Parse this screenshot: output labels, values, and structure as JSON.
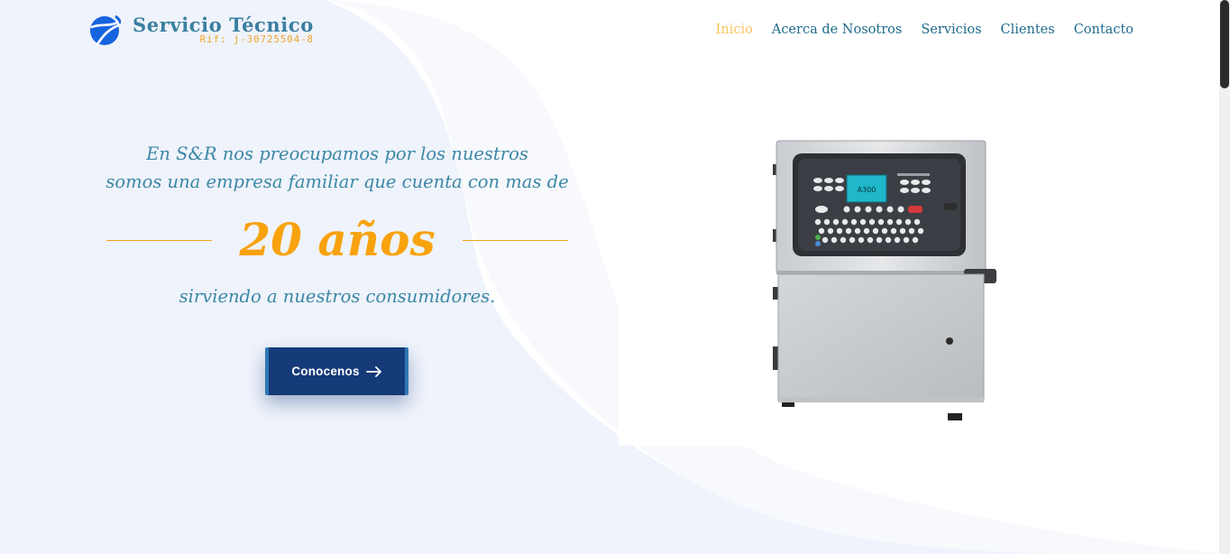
{
  "brand": {
    "name": "Servicio Técnico",
    "rif": "Rif: j-30725504-8",
    "logo_icon": "globe-swoosh-icon"
  },
  "nav": {
    "items": [
      {
        "label": "Inicio",
        "active": true
      },
      {
        "label": "Acerca de Nosotros",
        "active": false
      },
      {
        "label": "Servicios",
        "active": false
      },
      {
        "label": "Clientes",
        "active": false
      },
      {
        "label": "Contacto",
        "active": false
      }
    ]
  },
  "hero": {
    "line1": "En S&R nos preocupamos por los nuestros",
    "line2": "somos una empresa familiar que cuenta con mas de",
    "highlight": "20 años",
    "line3": "sirviendo a nuestros consumidores.",
    "cta_label": "Conocenos",
    "cta_icon": "arrow-right-icon"
  },
  "product": {
    "screen_text": "A300",
    "icon": "inkjet-printer-machine"
  },
  "colors": {
    "accent": "#f8a20e",
    "primary": "#1f6b8c",
    "button": "#153a78",
    "background_blob": "#eef2fb"
  }
}
